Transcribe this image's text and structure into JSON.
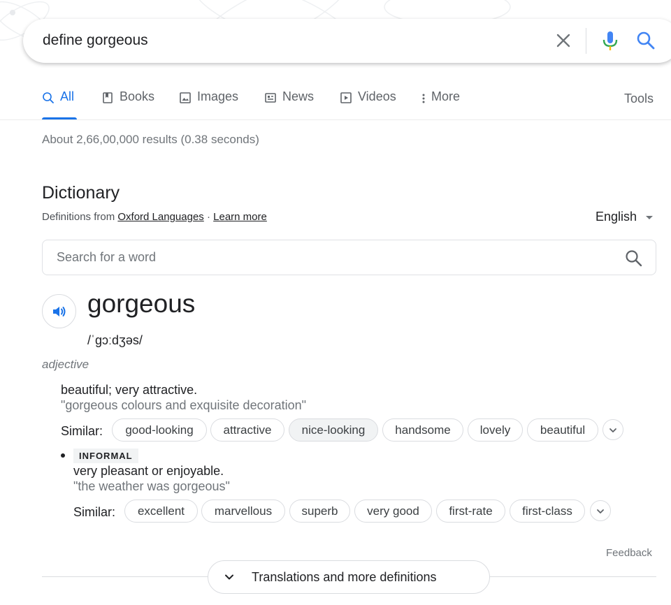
{
  "search": {
    "query": "define gorgeous"
  },
  "tabs": [
    {
      "label": "All",
      "icon": "search-icon",
      "active": true
    },
    {
      "label": "Books",
      "icon": "book-icon"
    },
    {
      "label": "Images",
      "icon": "image-icon"
    },
    {
      "label": "News",
      "icon": "news-icon"
    },
    {
      "label": "Videos",
      "icon": "video-icon"
    },
    {
      "label": "More",
      "icon": "more-vert-icon"
    }
  ],
  "tools_label": "Tools",
  "stats": "About 2,66,00,000 results (0.38 seconds)",
  "dictionary": {
    "title": "Dictionary",
    "source_prefix": "Definitions from ",
    "source_link": "Oxford Languages",
    "separator": " · ",
    "learn_more": "Learn more",
    "language": "English",
    "word_search_placeholder": "Search for a word",
    "headword": "gorgeous",
    "phonetic": "/ˈɡɔːdʒəs/",
    "part_of_speech": "adjective",
    "senses": [
      {
        "definition": "beautiful; very attractive.",
        "example": "\"gorgeous colours and exquisite decoration\"",
        "similar_label": "Similar:",
        "similar": [
          "good-looking",
          "attractive",
          "nice-looking",
          "handsome",
          "lovely",
          "beautiful"
        ]
      },
      {
        "label": "INFORMAL",
        "definition": "very pleasant or enjoyable.",
        "example": "\"the weather was gorgeous\"",
        "similar_label": "Similar:",
        "similar": [
          "excellent",
          "marvellous",
          "superb",
          "very good",
          "first-rate",
          "first-class"
        ]
      }
    ],
    "feedback": "Feedback",
    "more_definitions": "Translations and more definitions"
  },
  "colors": {
    "accent": "#1a73e8",
    "text": "#202124",
    "secondary": "#70757a"
  }
}
